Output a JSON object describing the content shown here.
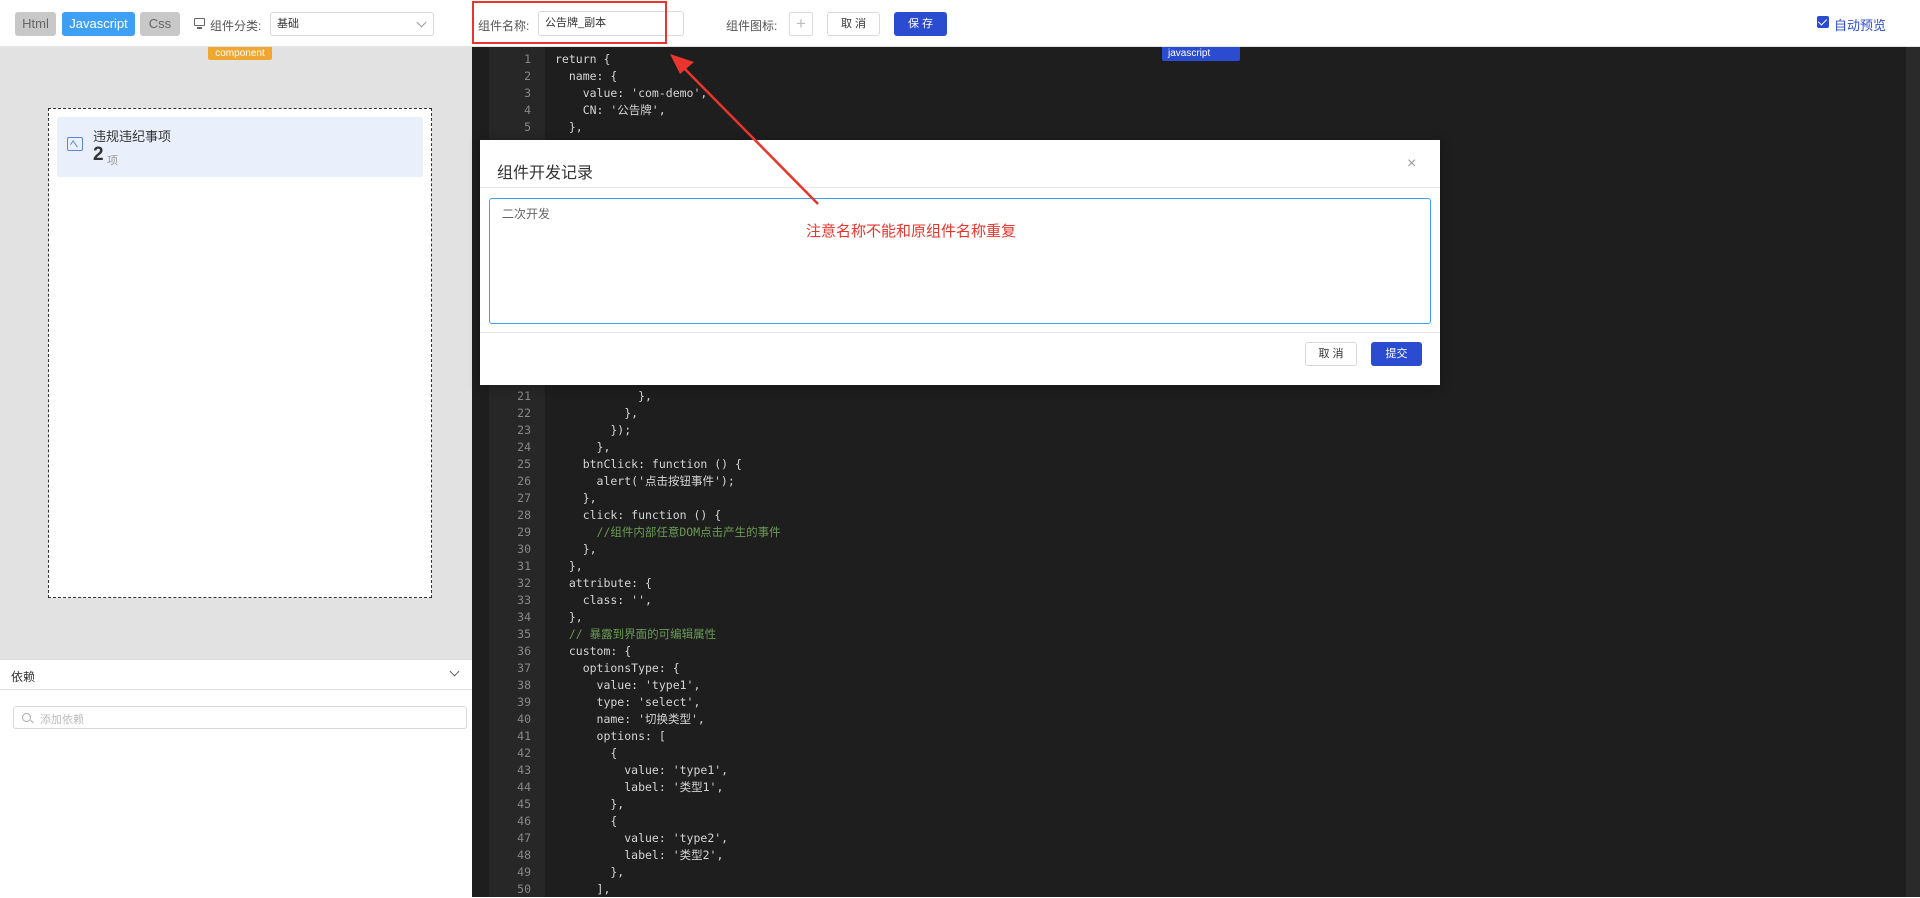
{
  "toolbar": {
    "tabs": [
      "Html",
      "Javascript",
      "Css"
    ],
    "category_label": "组件分类:",
    "category_value": "基础",
    "name_label": "组件名称:",
    "name_value": "公告牌_副本",
    "icon_label": "组件图标:",
    "plus": "+",
    "cancel": "取 消",
    "save": "保 存",
    "auto_preview": "自动预览"
  },
  "left": {
    "component_tag": "component",
    "card": {
      "title": "违规违纪事项",
      "number": "2",
      "unit": "项"
    },
    "dependency": {
      "title": "依赖",
      "placeholder": "添加依赖"
    }
  },
  "editor": {
    "language_tag": "javascript",
    "lines": [
      {
        "n": "1",
        "t": "return {"
      },
      {
        "n": "2",
        "t": "  name: {"
      },
      {
        "n": "3",
        "t": "    value: 'com-demo',"
      },
      {
        "n": "4",
        "t": "    CN: '公告牌',"
      },
      {
        "n": "5",
        "t": "  },"
      },
      {
        "n": "21",
        "t": "            },"
      },
      {
        "n": "22",
        "t": "          },"
      },
      {
        "n": "23",
        "t": "        });"
      },
      {
        "n": "24",
        "t": "      },"
      },
      {
        "n": "25",
        "t": "    btnClick: function () {"
      },
      {
        "n": "26",
        "t": "      alert('点击按钮事件');"
      },
      {
        "n": "27",
        "t": "    },"
      },
      {
        "n": "28",
        "t": "    click: function () {"
      },
      {
        "n": "29",
        "t": "      //组件内部任意DOM点击产生的事件"
      },
      {
        "n": "30",
        "t": "    },"
      },
      {
        "n": "31",
        "t": "  },"
      },
      {
        "n": "32",
        "t": "  attribute: {"
      },
      {
        "n": "33",
        "t": "    class: '',"
      },
      {
        "n": "34",
        "t": "  },"
      },
      {
        "n": "35",
        "t": "  // 暴露到界面的可编辑属性"
      },
      {
        "n": "36",
        "t": "  custom: {"
      },
      {
        "n": "37",
        "t": "    optionsType: {"
      },
      {
        "n": "38",
        "t": "      value: 'type1',"
      },
      {
        "n": "39",
        "t": "      type: 'select',"
      },
      {
        "n": "40",
        "t": "      name: '切换类型',"
      },
      {
        "n": "41",
        "t": "      options: ["
      },
      {
        "n": "42",
        "t": "        {"
      },
      {
        "n": "43",
        "t": "          value: 'type1',"
      },
      {
        "n": "44",
        "t": "          label: '类型1',"
      },
      {
        "n": "45",
        "t": "        },"
      },
      {
        "n": "46",
        "t": "        {"
      },
      {
        "n": "47",
        "t": "          value: 'type2',"
      },
      {
        "n": "48",
        "t": "          label: '类型2',"
      },
      {
        "n": "49",
        "t": "        },"
      },
      {
        "n": "50",
        "t": "      ],"
      }
    ]
  },
  "modal": {
    "title": "组件开发记录",
    "close": "×",
    "textarea": "二次开发",
    "cancel": "取 消",
    "submit": "提交"
  },
  "annotation": "注意名称不能和原组件名称重复",
  "colors": {
    "accent": "#2b4cd1",
    "tab_active": "#3ea0f5",
    "annotation": "#e8352d",
    "tag": "#f0a732"
  }
}
